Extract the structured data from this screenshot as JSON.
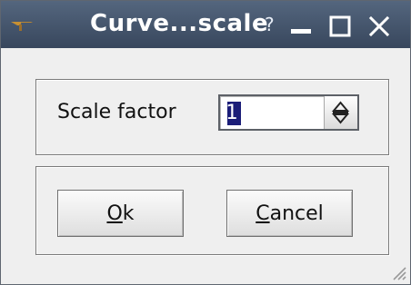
{
  "window": {
    "title": "Curve...scale",
    "help_glyph": "?",
    "icons": [
      "app-icon",
      "minimize-icon",
      "maximize-icon",
      "close-icon"
    ]
  },
  "form": {
    "scale_factor_label": "Scale factor",
    "scale_factor_value": "1"
  },
  "buttons": {
    "ok": {
      "mnemonic": "O",
      "rest": "k"
    },
    "cancel": {
      "mnemonic": "C",
      "rest": "ancel"
    }
  },
  "colors": {
    "titlebar": "#4a5d77",
    "selection": "#1b1d78"
  }
}
